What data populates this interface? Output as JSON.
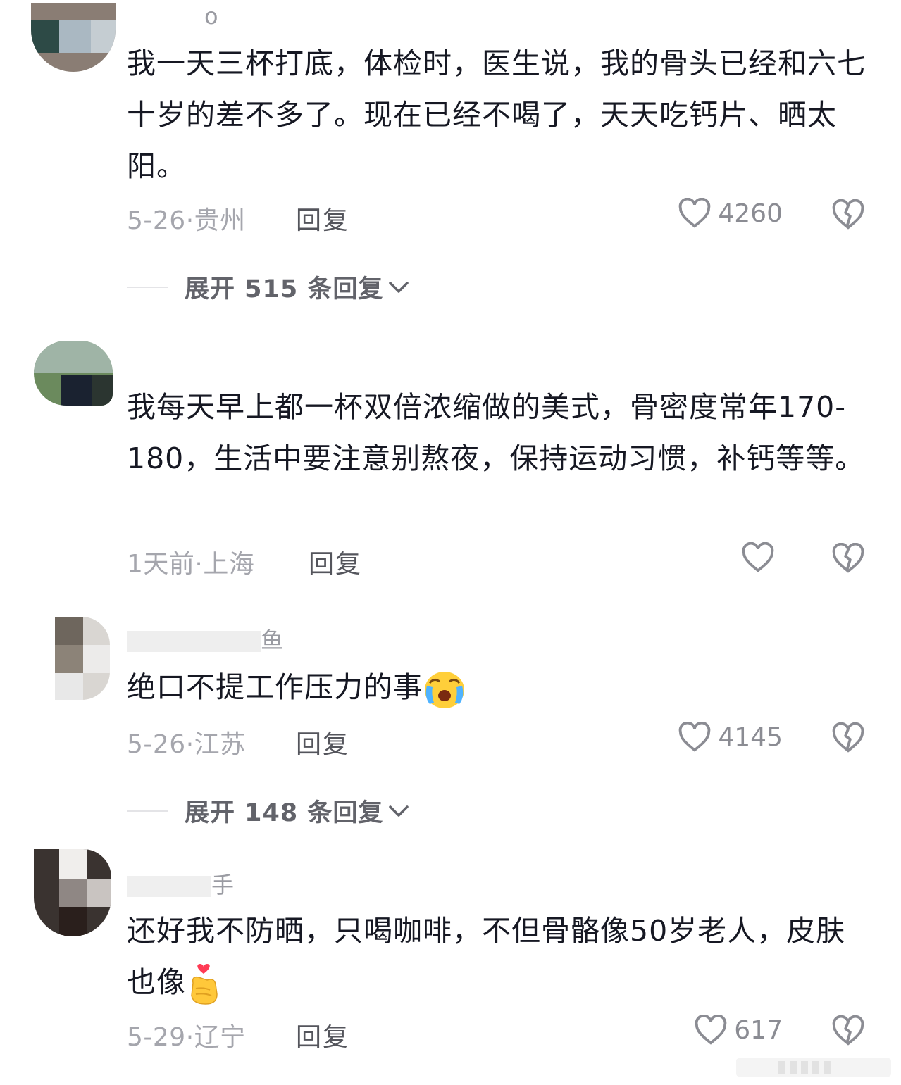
{
  "comments": [
    {
      "username": "o",
      "text": "我一天三杯打底，体检时，医生说，我的骨头已经和六七十岁的差不多了。现在已经不喝了，天天吃钙片、晒太阳。",
      "date": "5-26",
      "location": "贵州",
      "reply_label": "回复",
      "likes": "4260",
      "expand_label": "展开 515 条回复"
    },
    {
      "username": "",
      "text": "我每天早上都一杯双倍浓缩做的美式，骨密度常年170-180，生活中要注意别熬夜，保持运动习惯，补钙等等。",
      "date": "1天前",
      "location": "上海",
      "reply_label": "回复",
      "likes": ""
    },
    {
      "username": "鱼",
      "text": "绝口不提工作压力的事",
      "emoji": "crying-face-emoji",
      "date": "5-26",
      "location": "江苏",
      "reply_label": "回复",
      "likes": "4145",
      "expand_label": "展开 148 条回复"
    },
    {
      "username": "手",
      "text": "还好我不防晒，只喝咖啡，不但骨骼像50岁老人，皮肤也像",
      "emoji": "finger-heart-emoji",
      "date": "5-29",
      "location": "辽宁",
      "reply_label": "回复",
      "likes": "617"
    }
  ],
  "separator": "·",
  "colors": {
    "text": "#161823",
    "meta": "#a5a6ad",
    "reply": "#54555c",
    "icon": "#8b8c93"
  },
  "icons": [
    "heart-icon",
    "broken-heart-icon",
    "chevron-down-icon"
  ]
}
